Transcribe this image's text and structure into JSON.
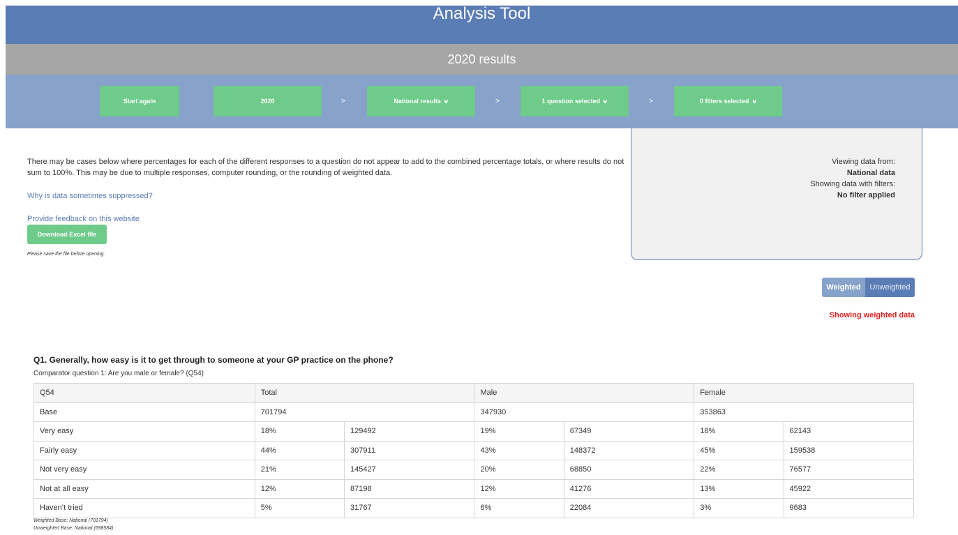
{
  "header": {
    "title": "Analysis Tool",
    "subtitle": "2020 results"
  },
  "nav": {
    "start_again": "Start again",
    "year": "2020",
    "arrow": ">",
    "results": "National results",
    "questions": "1 question selected",
    "filters": "0 filters selected"
  },
  "intro": {
    "text": "There may be cases below where percentages for each of the different responses to a question do not appear to add to the combined percentage totals, or where results do not sum to 100%. This may be due to multiple responses, computer rounding, or the rounding of weighted data.",
    "suppressed_link": "Why is data sometimes suppressed?",
    "feedback_link": "Provide feedback on this website",
    "download_label": "Download Excel file",
    "save_note": "Please save the file before opening."
  },
  "side_panel": {
    "viewing_label": "Viewing data from:",
    "viewing_value": "National data",
    "filters_label": "Showing data with filters:",
    "filters_value": "No filter applied"
  },
  "toggle": {
    "weighted": "Weighted",
    "unweighted": "Unweighted",
    "status": "Showing weighted data"
  },
  "question": {
    "title": "Q1. Generally, how easy is it to get through to someone at your GP practice on the phone?",
    "comparator": "Comparator question 1: Are you male or female? (Q54)"
  },
  "table": {
    "header": [
      "Q54",
      "Total",
      "Male",
      "Female"
    ],
    "base_label": "Base",
    "base": [
      "701794",
      "347930",
      "353863"
    ],
    "rows": [
      {
        "label": "Very easy",
        "values": [
          "18%",
          "129492",
          "19%",
          "67349",
          "18%",
          "62143"
        ]
      },
      {
        "label": "Fairly easy",
        "values": [
          "44%",
          "307911",
          "43%",
          "148372",
          "45%",
          "159538"
        ]
      },
      {
        "label": "Not very easy",
        "values": [
          "21%",
          "145427",
          "20%",
          "68850",
          "22%",
          "76577"
        ]
      },
      {
        "label": "Not at all easy",
        "values": [
          "12%",
          "87198",
          "12%",
          "41276",
          "13%",
          "45922"
        ]
      },
      {
        "label": "Haven’t tried",
        "values": [
          "5%",
          "31767",
          "6%",
          "22084",
          "3%",
          "9683"
        ]
      }
    ]
  },
  "footnotes": {
    "weighted_base": "Weighted Base: National (701794)",
    "unweighted_base": "Unweighted Base: National (698584)"
  },
  "colors": {
    "title_bar": "#5b7db5",
    "year_bar": "#a6a6a6",
    "nav_bar": "#87a2cb",
    "button_green": "#6fcb8a",
    "status_red": "#e02020"
  }
}
